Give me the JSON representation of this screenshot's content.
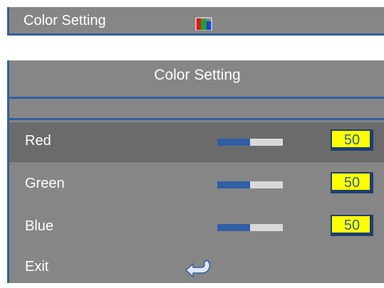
{
  "topbar": {
    "label": "Color Setting",
    "icon": "color-bars-icon"
  },
  "panel": {
    "title": "Color Setting",
    "rows": [
      {
        "label": "Red",
        "value": "50",
        "level_percent": 50,
        "selected": true
      },
      {
        "label": "Green",
        "value": "50",
        "level_percent": 50,
        "selected": false
      },
      {
        "label": "Blue",
        "value": "50",
        "level_percent": 50,
        "selected": false
      }
    ],
    "exit": {
      "label": "Exit",
      "icon": "return-arrow-icon"
    }
  },
  "colors": {
    "accent": "#2f5fa5",
    "panel_bg": "#868686",
    "selected_bg": "#6b6b6b",
    "value_box": "#ffff00",
    "slider_track": "#d9d9d9"
  }
}
